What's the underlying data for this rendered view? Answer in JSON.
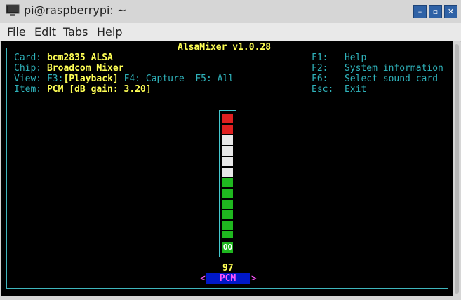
{
  "window": {
    "title": "pi@raspberrypi: ~",
    "minimize": "–",
    "maximize": "▫",
    "close": "✕"
  },
  "menu": [
    "File",
    "Edit",
    "Tabs",
    "Help"
  ],
  "mixer": {
    "title": "AlsaMixer v1.0.28",
    "card_label": "Card:",
    "card_value": "bcm2835 ALSA",
    "chip_label": "Chip:",
    "chip_value": "Broadcom Mixer",
    "view_label": "View:",
    "view_f3": "F3:",
    "view_playback": "[Playback]",
    "view_f4": "F4: Capture",
    "view_f5": "F5: All",
    "item_label": "Item:",
    "item_value": "PCM [dB gain: 3.20]",
    "help": [
      {
        "key": "F1:",
        "action": "Help"
      },
      {
        "key": "F2:",
        "action": "System information"
      },
      {
        "key": "F6:",
        "action": "Select sound card"
      },
      {
        "key": "Esc:",
        "action": "Exit"
      }
    ],
    "control": {
      "volume_percent": 97,
      "volume_text": "97",
      "mute_text": "OO",
      "name": "PCM",
      "left_arrow": "<",
      "right_arrow": ">"
    }
  },
  "colors": {
    "frame": "#3fb6bd",
    "label": "#2fb3bb",
    "value": "#ffff55",
    "bar_red": "#e02020",
    "bar_white": "#e8e8e8",
    "bar_green": "#1fb81f",
    "selected_bg": "#0018c8",
    "selected_fg": "#ff55ff"
  }
}
